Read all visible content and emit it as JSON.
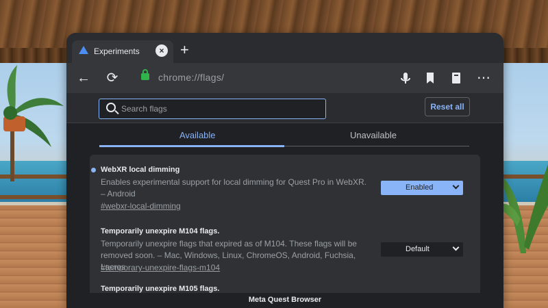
{
  "browser": {
    "tab": {
      "title": "Experiments",
      "favicon": "flask-icon",
      "close_icon": "×"
    },
    "new_tab_icon": "+",
    "toolbar": {
      "back_icon": "←",
      "reload_icon": "⟳",
      "url": "chrome://flags/",
      "mic_icon": "microphone-icon",
      "bookmark_icon": "bookmark-icon",
      "reader_icon": "book-icon",
      "menu_icon": "⋯"
    },
    "footer_label": "Meta Quest Browser"
  },
  "flags_page": {
    "search": {
      "placeholder": "Search flags"
    },
    "reset_label": "Reset all",
    "tabs": [
      {
        "label": "Available",
        "active": true
      },
      {
        "label": "Unavailable",
        "active": false
      }
    ],
    "flags": [
      {
        "title": "WebXR local dimming",
        "modified": true,
        "description": "Enables experimental support for local dimming for Quest Pro in WebXR. – Android",
        "link": "#webxr-local-dimming",
        "value": "Enabled"
      },
      {
        "title": "Temporarily unexpire M104 flags.",
        "modified": false,
        "description": "Temporarily unexpire flags that expired as of M104. These flags will be removed soon. – Mac, Windows, Linux, ChromeOS, Android, Fuchsia, Lacros",
        "link": "#temporary-unexpire-flags-m104",
        "value": "Default"
      },
      {
        "title": "Temporarily unexpire M105 flags.",
        "modified": false
      }
    ]
  },
  "colors": {
    "accent": "#8ab4f8",
    "panel_bg": "#1f2124",
    "card_bg": "#2f3134",
    "lock_green": "#2fb34a"
  }
}
